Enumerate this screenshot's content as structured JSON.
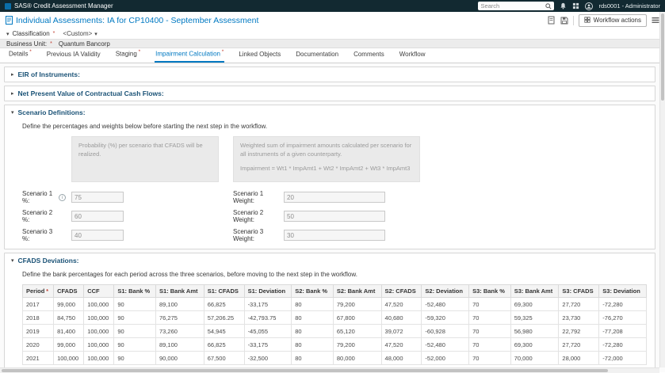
{
  "required_marker": "*",
  "glyphs": {
    "collapsed": "▸",
    "expanded": "▾",
    "dropdown_caret": "▾",
    "info": "i"
  },
  "topbar": {
    "app_title": "SAS® Credit Assessment Manager",
    "search_placeholder": "Search",
    "user": "rds0001 - Administrator"
  },
  "header": {
    "title": "Individual Assessments: IA for CP10400 - September Assessment",
    "workflow_actions_label": "Workflow actions"
  },
  "classification": {
    "label": "Classification",
    "value": "<Custom>"
  },
  "business_unit": {
    "label": "Business Unit:",
    "value": "Quantum Bancorp"
  },
  "tabs": [
    {
      "label": "Details",
      "required": true
    },
    {
      "label": "Previous IA Validity"
    },
    {
      "label": "Staging",
      "required": true
    },
    {
      "label": "Impairment Calculation",
      "required": true,
      "active": true
    },
    {
      "label": "Linked Objects"
    },
    {
      "label": "Documentation"
    },
    {
      "label": "Comments"
    },
    {
      "label": "Workflow"
    }
  ],
  "sections": {
    "eir": {
      "title": "EIR of Instruments:"
    },
    "npv": {
      "title": "Net Present Value of Contractual Cash Flows:"
    },
    "scenario": {
      "title": "Scenario Definitions:",
      "intro": "Define the percentages and weights below before starting the next step in the workflow.",
      "probability_note": "Probability (%) per scenario that CFADS will be realized.",
      "weight_note_line1": "Weighted sum of impairment amounts calculated per scenario for all instruments of a given counterparty.",
      "weight_note_line2": "Impairment = Wt1 * ImpAmt1 + Wt2 * ImpAmt2 + Wt3 * ImpAmt3",
      "rows": [
        {
          "pct_label": "Scenario 1 %:",
          "pct_value": "75",
          "wt_label": "Scenario 1 Weight:",
          "wt_value": "20"
        },
        {
          "pct_label": "Scenario 2 %:",
          "pct_value": "60",
          "wt_label": "Scenario 2 Weight:",
          "wt_value": "50"
        },
        {
          "pct_label": "Scenario 3 %:",
          "pct_value": "40",
          "wt_label": "Scenario 3 Weight:",
          "wt_value": "30"
        }
      ]
    },
    "cfads": {
      "title": "CFADS Deviations:",
      "intro": "Define the bank percentages for each period across the three scenarios, before moving to the next step in the workflow.",
      "table": {
        "columns": [
          {
            "label": "Period",
            "required": true
          },
          {
            "label": "CFADS"
          },
          {
            "label": "CCF"
          },
          {
            "label": "S1: Bank %"
          },
          {
            "label": "S1: Bank Amt"
          },
          {
            "label": "S1: CFADS"
          },
          {
            "label": "S1: Deviation"
          },
          {
            "label": "S2: Bank %"
          },
          {
            "label": "S2: Bank Amt"
          },
          {
            "label": "S2: CFADS"
          },
          {
            "label": "S2: Deviation"
          },
          {
            "label": "S3: Bank %"
          },
          {
            "label": "S3: Bank Amt"
          },
          {
            "label": "S3: CFADS"
          },
          {
            "label": "S3: Deviation"
          }
        ],
        "rows": [
          [
            "2017",
            "99,000",
            "100,000",
            "90",
            "89,100",
            "66,825",
            "-33,175",
            "80",
            "79,200",
            "47,520",
            "-52,480",
            "70",
            "69,300",
            "27,720",
            "-72,280"
          ],
          [
            "2018",
            "84,750",
            "100,000",
            "90",
            "76,275",
            "57,206.25",
            "-42,793.75",
            "80",
            "67,800",
            "40,680",
            "-59,320",
            "70",
            "59,325",
            "23,730",
            "-76,270"
          ],
          [
            "2019",
            "81,400",
            "100,000",
            "90",
            "73,260",
            "54,945",
            "-45,055",
            "80",
            "65,120",
            "39,072",
            "-60,928",
            "70",
            "56,980",
            "22,792",
            "-77,208"
          ],
          [
            "2020",
            "99,000",
            "100,000",
            "90",
            "89,100",
            "66,825",
            "-33,175",
            "80",
            "79,200",
            "47,520",
            "-52,480",
            "70",
            "69,300",
            "27,720",
            "-72,280"
          ],
          [
            "2021",
            "100,000",
            "100,000",
            "90",
            "90,000",
            "67,500",
            "-32,500",
            "80",
            "80,000",
            "48,000",
            "-52,000",
            "70",
            "70,000",
            "28,000",
            "-72,000"
          ]
        ]
      }
    }
  }
}
